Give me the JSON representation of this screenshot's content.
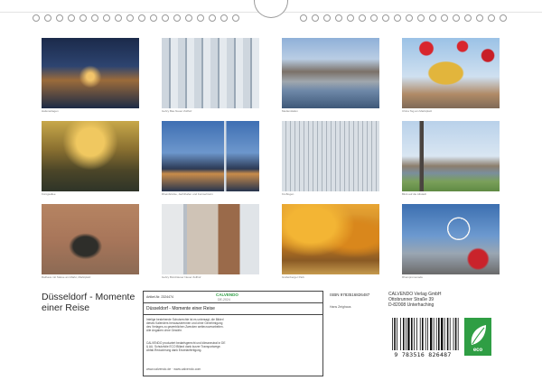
{
  "captions": [
    "Hafenanlagen",
    "Gehry Bau Neuer Zollhof",
    "MedienHafen",
    "China Tag am Marktplatz",
    "Königsallee",
    "Rheinbrücke, Jachthafen und Fernsehturm",
    "Kö-Bogen",
    "Blick auf die Altstadt",
    "Rathaus mit Statue am Markt, Marktplatz",
    "Gehry Bürohäuser Neuer Zollhof",
    "Grafenberger Park",
    "Rheinpromenade"
  ],
  "title": "Düsseldorf - Momente einer Reise",
  "info": {
    "article_label": "Artikel-Nr. 2324474",
    "logo": "CALVENDO",
    "logo_sub": "DE-2024",
    "calendar_title": "Düsseldorf - Momente einer Reise",
    "description": "Intelige bestehende Schutzrechte ist es untersagt, die Bilder/ dieses Kalenders herauszutrennen und ohne Genehmigung des Verlages zu gewerblichen Zwecken weiterzuverarbeiten. Alle Angaben ohne Gewähr.",
    "env_text": "CALVENDO produziert bedarfsgerecht und klimaneutral in DE & AU. Schutzfolie ECO Billard dank kurzer Transportwege. Abfall-Reduzierung dank Einzelanfertigung.",
    "url": "www.calvendo.de · www.calvendo.com"
  },
  "isbn_label": "ISBN 9783516826487",
  "author": "Hans Zeighaus",
  "publisher": {
    "line1": "CALVENDO Verlag GmbH",
    "line2": "Ottobrunner Straße 39",
    "line3": "D-82008 Unterhaching"
  },
  "barcode_digits": "9 783516 826487",
  "eco_label": "eco"
}
